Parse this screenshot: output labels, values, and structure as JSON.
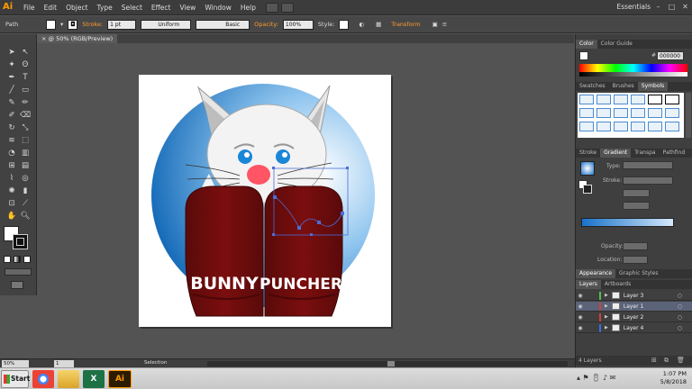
{
  "app": {
    "logo_text": "Ai",
    "menus": [
      "File",
      "Edit",
      "Object",
      "Type",
      "Select",
      "Effect",
      "View",
      "Window",
      "Help"
    ],
    "workspace": "Essentials",
    "window_buttons": [
      "–",
      "□",
      "✕"
    ]
  },
  "control_bar": {
    "object_type": "Path",
    "stroke_label": "Stroke:",
    "stroke_weight": "1 pt",
    "profile": "Uniform",
    "brush": "Basic",
    "opacity_label": "Opacity:",
    "opacity_value": "100%",
    "style_label": "Style:",
    "transform_label": "Transform"
  },
  "document": {
    "tab_title": "@ 50% (RGB/Preview)",
    "close_glyph": "×"
  },
  "artwork": {
    "text_left": "BUNNY",
    "text_right": "PUNCHER"
  },
  "panels": {
    "color_tabs": [
      "Color",
      "Color Guide"
    ],
    "hex_value": "000000",
    "library_tabs": [
      "Swatches",
      "Brushes",
      "Symbols"
    ],
    "gradient_tabs": [
      "Stroke",
      "Gradient",
      "Transpa",
      "Pathfind"
    ],
    "type_label": "Type:",
    "stroke_label": "Stroke:",
    "opacity_label": "Opacity:",
    "location_label": "Location:",
    "appearance_tabs": [
      "Appearance",
      "Graphic Styles"
    ],
    "layers_tabs": [
      "Layers",
      "Artboards"
    ],
    "layers": [
      {
        "name": "Layer 3",
        "color": "#4fc14f"
      },
      {
        "name": "Layer 1",
        "color": "#d04040"
      },
      {
        "name": "Layer 2",
        "color": "#d04040"
      },
      {
        "name": "Layer 4",
        "color": "#3b6fd8"
      }
    ],
    "layers_count": "4 Layers"
  },
  "status_bar": {
    "zoom": "50%",
    "artboard_number": "1",
    "tool_name": "Selection"
  },
  "taskbar": {
    "start_label": "Start",
    "time": "1:07 PM",
    "date": "5/8/2018"
  }
}
